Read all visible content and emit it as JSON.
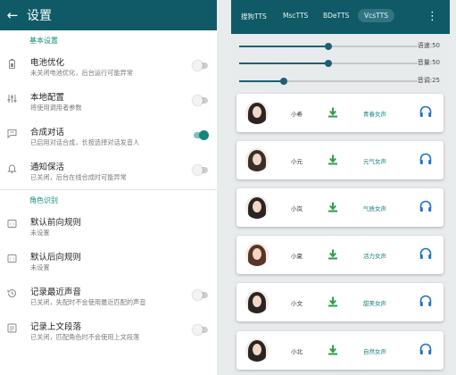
{
  "settings": {
    "title": "设置",
    "back_icon": "arrow-back-icon",
    "colors": {
      "appbar": "#0f5a66",
      "accent": "#128c7e",
      "switch_on": "#13877d"
    },
    "sections": [
      {
        "header": "基本设置",
        "items": [
          {
            "icon": "battery-icon",
            "title": "电池优化",
            "subtitle": "未关闭电池优化，后台运行可能异常",
            "toggle": false
          },
          {
            "icon": "equalizer-icon",
            "title": "本地配置",
            "subtitle": "将使用调用者参数",
            "toggle": false
          },
          {
            "icon": "chat-icon",
            "title": "合成对话",
            "subtitle": "已启用对话合成，长按选择对话发音人",
            "toggle": true
          },
          {
            "icon": "bell-icon",
            "title": "通知保活",
            "subtitle": "已关闭，后台在线合成时可能异常",
            "toggle": false
          }
        ]
      },
      {
        "header": "角色识别",
        "items": [
          {
            "icon": "rule-icon",
            "title": "默认前向规则",
            "subtitle": "未设置",
            "toggle": null
          },
          {
            "icon": "rule-icon",
            "title": "默认后向规则",
            "subtitle": "未设置",
            "toggle": null
          },
          {
            "icon": "history-icon",
            "title": "记录最近声音",
            "subtitle": "已关闭，失配时不会使用最近匹配的声音",
            "toggle": false
          },
          {
            "icon": "paragraph-icon",
            "title": "记录上文段落",
            "subtitle": "已关闭，匹配角色时不会使用上文段落",
            "toggle": false
          }
        ]
      }
    ]
  },
  "tts": {
    "tabs": [
      "搜狗TTS",
      "MscTTS",
      "BDeTTS",
      "VcsTTS"
    ],
    "active_tab": "VcsTTS",
    "menu_icon": "more-vert-icon",
    "sliders": [
      {
        "label": "语速:50",
        "value": 50,
        "max": 100
      },
      {
        "label": "音量:50",
        "value": 50,
        "max": 100
      },
      {
        "label": "音调:25",
        "value": 25,
        "max": 100
      }
    ],
    "voices": [
      {
        "name": "小希",
        "type": "青春女声",
        "download_icon": "download-icon",
        "listen_icon": "headphones-icon"
      },
      {
        "name": "小元",
        "type": "元气女声",
        "download_icon": "download-icon",
        "listen_icon": "headphones-icon"
      },
      {
        "name": "小岚",
        "type": "气质女声",
        "download_icon": "download-icon",
        "listen_icon": "headphones-icon"
      },
      {
        "name": "小夏",
        "type": "活力女声",
        "download_icon": "download-icon",
        "listen_icon": "headphones-icon"
      },
      {
        "name": "小文",
        "type": "甜美女声",
        "download_icon": "download-icon",
        "listen_icon": "headphones-icon"
      },
      {
        "name": "小北",
        "type": "自然女声",
        "download_icon": "download-icon",
        "listen_icon": "headphones-icon"
      }
    ]
  }
}
